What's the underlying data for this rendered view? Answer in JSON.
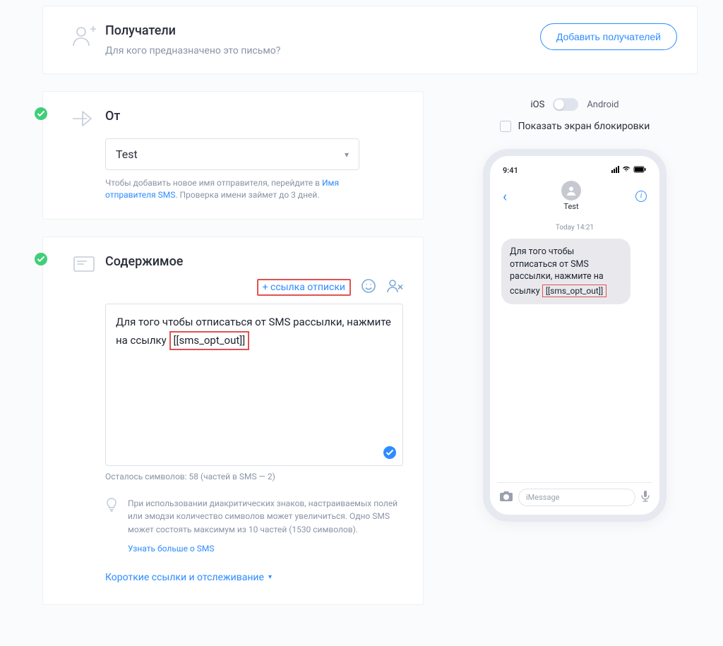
{
  "recipients": {
    "title": "Получатели",
    "subtitle": "Для кого предназначено это письмо?",
    "add_button": "Добавить получателей"
  },
  "from": {
    "title": "От",
    "selected": "Test",
    "hint_prefix": "Чтобы добавить новое имя отправителя, перейдите в",
    "hint_link": "Имя отправителя SMS",
    "hint_suffix": ". Проверка имени займет до 3 дней."
  },
  "content": {
    "title": "Содержимое",
    "unsub_link_button": "+ ссылка отписки",
    "message_value": "Для того чтобы отписаться от SMS рассылки, нажмите на ссылку",
    "message_tag": "[[sms_opt_out]]",
    "counter": "Осталось символов: 58 (частей в SMS — 2)",
    "tip": "При использовании диакритических знаков, настраиваемых полей или эмодзи количество символов может увеличиться. Одно SMS может состоять максимум из 10 частей (1530 символов).",
    "learn_more": "Узнать больше о SMS",
    "tracking_link": "Короткие ссылки и отслеживание"
  },
  "preview": {
    "ios_label": "iOS",
    "android_label": "Android",
    "lockscreen_label": "Показать экран блокировки",
    "status_time": "9:41",
    "contact_name": "Test",
    "today_label": "Today 14:21",
    "bubble_line": "Для того чтобы отписаться от SMS рассылки, нажмите на ссылку",
    "bubble_tag": "[[sms_opt_out]]",
    "imessage_placeholder": "iMessage"
  }
}
